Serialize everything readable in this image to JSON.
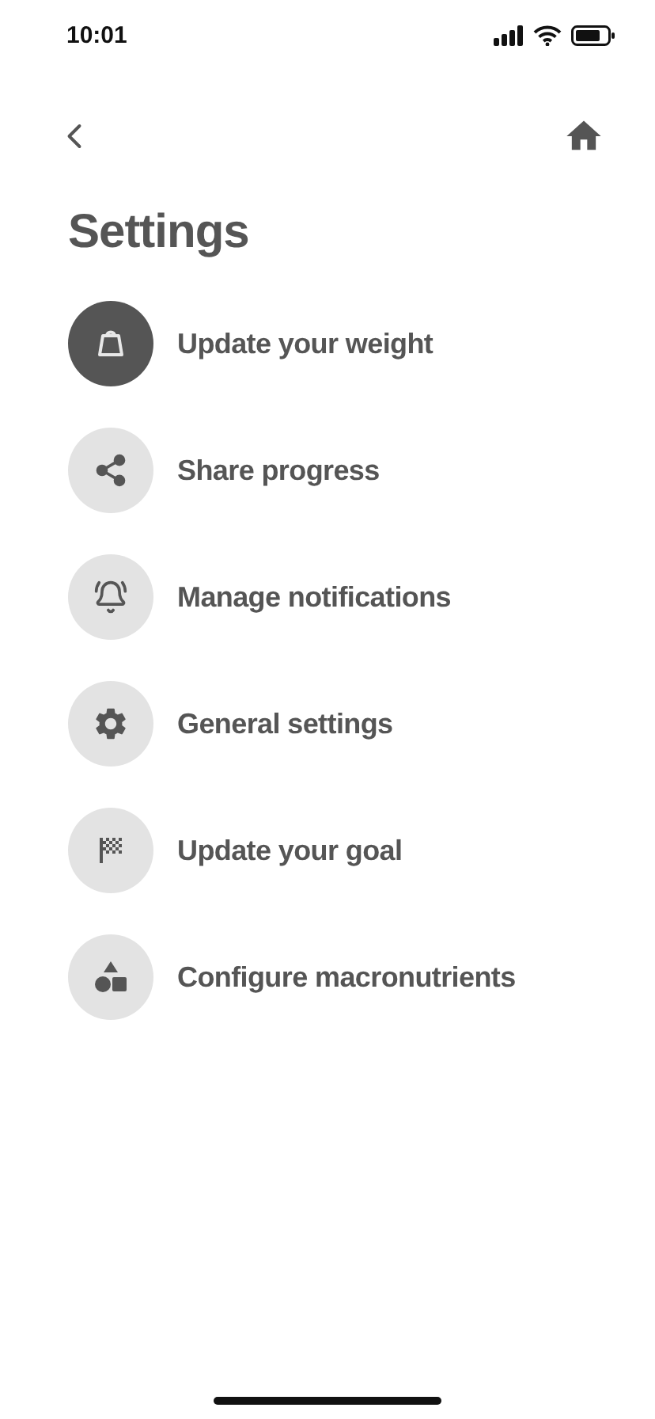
{
  "status_bar": {
    "time": "10:01"
  },
  "title": "Settings",
  "items": [
    {
      "label": "Update your weight",
      "kind": "weight",
      "selected": true
    },
    {
      "label": "Share progress",
      "kind": "share",
      "selected": false
    },
    {
      "label": "Manage notifications",
      "kind": "bell",
      "selected": false
    },
    {
      "label": "General settings",
      "kind": "gear",
      "selected": false
    },
    {
      "label": "Update your goal",
      "kind": "flag",
      "selected": false
    },
    {
      "label": "Configure macronutrients",
      "kind": "shapes",
      "selected": false
    }
  ]
}
